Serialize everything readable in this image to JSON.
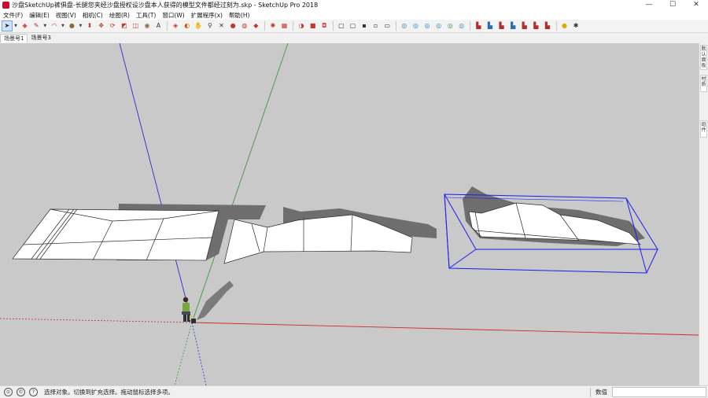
{
  "window": {
    "title": "沙盘SketchUp裤俱盘-长腿您夹经沙盘授权设沙盘本人获得的模型文件都经过刻为.skp - SketchUp Pro 2018",
    "min_glyph": "—",
    "max_glyph": "☐",
    "close_glyph": "✕"
  },
  "menu": [
    "文件(F)",
    "编辑(E)",
    "视图(V)",
    "相机(C)",
    "绘图(R)",
    "工具(T)",
    "窗口(W)",
    "扩展程序(x)",
    "帮助(H)"
  ],
  "toolbar": {
    "tools": [
      {
        "icon": "select-arrow-icon",
        "glyph": "➤",
        "color": "#222"
      },
      {
        "icon": "eraser-icon",
        "glyph": "◆",
        "color": "#d9534f"
      },
      {
        "icon": "pencil-line-icon",
        "glyph": "✎",
        "color": "#b03030"
      },
      {
        "icon": "arc-icon",
        "glyph": "◠",
        "color": "#c0392b"
      },
      {
        "icon": "circle-shape-icon",
        "glyph": "●",
        "color": "#8a6d3b"
      },
      {
        "icon": "push-pull-icon",
        "glyph": "⬍",
        "color": "#c0392b"
      },
      {
        "icon": "move-icon",
        "glyph": "✥",
        "color": "#c0392b"
      },
      {
        "icon": "rotate-icon",
        "glyph": "⟳",
        "color": "#c0392b"
      },
      {
        "icon": "scale-icon",
        "glyph": "◩",
        "color": "#c0392b"
      },
      {
        "icon": "offset-icon",
        "glyph": "◫",
        "color": "#c0392b"
      },
      {
        "icon": "tape-measure-icon",
        "glyph": "◉",
        "color": "#8a6d3b"
      },
      {
        "icon": "text-label-icon",
        "glyph": "A",
        "color": "#333"
      },
      {
        "icon": "paint-bucket-icon",
        "glyph": "◈",
        "color": "#c0392b"
      },
      {
        "icon": "orbit-icon",
        "glyph": "◐",
        "color": "#d35400"
      },
      {
        "icon": "pan-icon",
        "glyph": "✋",
        "color": "#8a6d3b"
      },
      {
        "icon": "zoom-icon",
        "glyph": "⚲",
        "color": "#333"
      },
      {
        "icon": "zoom-extents-icon",
        "glyph": "✕",
        "color": "#333"
      },
      {
        "icon": "warehouse-icon",
        "glyph": "●",
        "color": "#c0392b"
      },
      {
        "icon": "components-icon",
        "glyph": "◍",
        "color": "#c0392b"
      },
      {
        "icon": "extension-warehouse-icon",
        "glyph": "◆",
        "color": "#c0392b"
      },
      {
        "icon": "sun-settings-icon",
        "glyph": "✺",
        "color": "#c0392b"
      },
      {
        "icon": "layers-icon",
        "glyph": "▦",
        "color": "#c0392b"
      },
      {
        "icon": "section-plane-icon",
        "glyph": "◑",
        "color": "#c0392b"
      },
      {
        "icon": "section-fill-icon",
        "glyph": "■",
        "color": "#c0392b"
      },
      {
        "icon": "section-display-icon",
        "glyph": "◘",
        "color": "#d9534f"
      },
      {
        "icon": "view-iso-icon",
        "glyph": "▢",
        "color": "#333"
      },
      {
        "icon": "view-top-icon",
        "glyph": "▢",
        "color": "#333"
      },
      {
        "icon": "view-front-icon",
        "glyph": "▪",
        "color": "#333"
      },
      {
        "icon": "view-right-icon",
        "glyph": "▫",
        "color": "#333"
      },
      {
        "icon": "view-back-icon",
        "glyph": "▭",
        "color": "#333"
      },
      {
        "icon": "xray-style-icon",
        "glyph": "◎",
        "color": "#2e7fb8"
      },
      {
        "icon": "wireframe-style-icon",
        "glyph": "◎",
        "color": "#2e7fb8"
      },
      {
        "icon": "hidden-line-style-icon",
        "glyph": "◎",
        "color": "#2e7fb8"
      },
      {
        "icon": "shaded-style-icon",
        "glyph": "◎",
        "color": "#2e7fb8"
      },
      {
        "icon": "textured-style-icon",
        "glyph": "◎",
        "color": "#2e8f4a"
      },
      {
        "icon": "monochrome-style-icon",
        "glyph": "◎",
        "color": "#2e7fb8"
      },
      {
        "icon": "sandbox-from-contours-icon",
        "glyph": "▙",
        "color": "#b03030"
      },
      {
        "icon": "sandbox-from-scratch-icon",
        "glyph": "▙",
        "color": "#2a6fb0"
      },
      {
        "icon": "sandbox-smoove-icon",
        "glyph": "▙",
        "color": "#b03030"
      },
      {
        "icon": "sandbox-stamp-icon",
        "glyph": "▙",
        "color": "#2a6fb0"
      },
      {
        "icon": "sandbox-drape-icon",
        "glyph": "▙",
        "color": "#b03030"
      },
      {
        "icon": "sandbox-add-detail-icon",
        "glyph": "▙",
        "color": "#b03030"
      },
      {
        "icon": "sandbox-flip-edge-icon",
        "glyph": "▙",
        "color": "#b03030"
      },
      {
        "icon": "geo-location-icon",
        "glyph": "●",
        "color": "#e0a800"
      },
      {
        "icon": "extension-tool-icon",
        "glyph": "✱",
        "color": "#333"
      }
    ]
  },
  "scene_tabs": [
    "场景号1",
    "场景号3"
  ],
  "right_panel_tabs": [
    "默认面板",
    "材质",
    "组件"
  ],
  "status": {
    "message": "选择对象。切换到扩充选择。拖动鼠标选择多项。",
    "measurements_label": "数值",
    "icons": [
      "geo-location-icon",
      "credits-icon",
      "help-icon"
    ]
  },
  "colors": {
    "axis_red": "#cc2b2b",
    "axis_green": "#3c9a3c",
    "axis_blue": "#2b2bcc",
    "viewport_bg": "#c9c9c9",
    "selection_blue": "#1c1cf0",
    "shadow": "#6e6e6e"
  }
}
